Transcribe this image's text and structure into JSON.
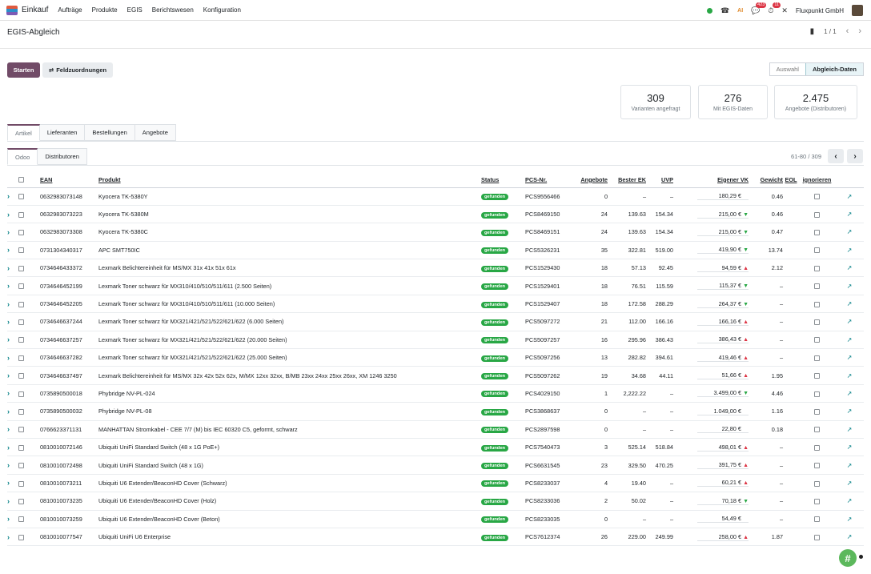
{
  "navbar": {
    "brand": "Einkauf",
    "menu": [
      "Aufträge",
      "Produkte",
      "EGIS",
      "Berichtswesen",
      "Konfiguration"
    ],
    "messages_badge": "423",
    "activity_badge": "11",
    "ai_label": "AI",
    "company": "Fluxpunkt GmbH"
  },
  "control": {
    "title": "EGIS-Abgleich",
    "pager": "1 / 1",
    "start_label": "Starten",
    "field_map_label": "Feldzuordnungen",
    "steps": [
      "Auswahl",
      "Abgleich-Daten"
    ]
  },
  "stats": [
    {
      "value": "309",
      "label": "Varianten angefragt"
    },
    {
      "value": "276",
      "label": "Mit EGIS-Daten"
    },
    {
      "value": "2.475",
      "label": "Angebote (Distributoren)"
    }
  ],
  "tabs": [
    "Artikel",
    "Lieferanten",
    "Bestellungen",
    "Angebote"
  ],
  "subtabs": [
    "Odoo",
    "Distributoren"
  ],
  "list_pager": "61-80 / 309",
  "columns": {
    "ean": "EAN",
    "produkt": "Produkt",
    "status": "Status",
    "pcs": "PCS-Nr.",
    "angebote": "Angebote",
    "bester_ek": "Bester EK",
    "uvp": "UVP",
    "eigener_vk": "Eigener VK",
    "gewicht": "Gewicht",
    "eol": "EOL",
    "ignorieren": "ignorieren"
  },
  "rows": [
    {
      "ean": "0632983073148",
      "produkt": "Kyocera TK-5380Y",
      "status": "gefunden",
      "pcs": "PCS9556466",
      "angebote": "0",
      "ek": "–",
      "uvp": "–",
      "vk": "180,29 €",
      "trend": "",
      "gewicht": "0.46"
    },
    {
      "ean": "0632983073223",
      "produkt": "Kyocera TK-5380M",
      "status": "gefunden",
      "pcs": "PCS8469150",
      "angebote": "24",
      "ek": "139.63",
      "uvp": "154.34",
      "vk": "215,00 €",
      "trend": "down",
      "gewicht": "0.46"
    },
    {
      "ean": "0632983073308",
      "produkt": "Kyocera TK-5380C",
      "status": "gefunden",
      "pcs": "PCS8469151",
      "angebote": "24",
      "ek": "139.63",
      "uvp": "154.34",
      "vk": "215,00 €",
      "trend": "down",
      "gewicht": "0.47"
    },
    {
      "ean": "0731304340317",
      "produkt": "APC SMT750IC",
      "status": "gefunden",
      "pcs": "PCS5326231",
      "angebote": "35",
      "ek": "322.81",
      "uvp": "519.00",
      "vk": "419,90 €",
      "trend": "down",
      "gewicht": "13.74"
    },
    {
      "ean": "0734646433372",
      "produkt": "Lexmark Belichtereinheit für MS/MX 31x 41x 51x 61x",
      "status": "gefunden",
      "pcs": "PCS1529430",
      "angebote": "18",
      "ek": "57.13",
      "uvp": "92.45",
      "vk": "94,59 €",
      "trend": "up",
      "gewicht": "2.12"
    },
    {
      "ean": "0734646452199",
      "produkt": "Lexmark Toner schwarz für MX310/410/510/511/611 (2.500 Seiten)",
      "status": "gefunden",
      "pcs": "PCS1529401",
      "angebote": "18",
      "ek": "76.51",
      "uvp": "115.59",
      "vk": "115,37 €",
      "trend": "down",
      "gewicht": "–"
    },
    {
      "ean": "0734646452205",
      "produkt": "Lexmark Toner schwarz für MX310/410/510/511/611 (10.000 Seiten)",
      "status": "gefunden",
      "pcs": "PCS1529407",
      "angebote": "18",
      "ek": "172.58",
      "uvp": "288.29",
      "vk": "264,37 €",
      "trend": "down",
      "gewicht": "–"
    },
    {
      "ean": "0734646637244",
      "produkt": "Lexmark Toner schwarz für MX321/421/521/522/621/622 (6.000 Seiten)",
      "status": "gefunden",
      "pcs": "PCS5097272",
      "angebote": "21",
      "ek": "112.00",
      "uvp": "166.16",
      "vk": "166,16 €",
      "trend": "up",
      "gewicht": "–"
    },
    {
      "ean": "0734646637257",
      "produkt": "Lexmark Toner schwarz für MX321/421/521/522/621/622 (20.000 Seiten)",
      "status": "gefunden",
      "pcs": "PCS5097257",
      "angebote": "16",
      "ek": "295.96",
      "uvp": "386.43",
      "vk": "386,43 €",
      "trend": "up",
      "gewicht": "–"
    },
    {
      "ean": "0734646637282",
      "produkt": "Lexmark Toner schwarz für MX321/421/521/522/621/622 (25.000 Seiten)",
      "status": "gefunden",
      "pcs": "PCS5097256",
      "angebote": "13",
      "ek": "282.82",
      "uvp": "394.61",
      "vk": "419,46 €",
      "trend": "up",
      "gewicht": "–"
    },
    {
      "ean": "0734646637497",
      "produkt": "Lexmark Belichtereinheit für MS/MX 32x 42x 52x 62x, M/MX 12xx 32xx, B/MB 23xx 24xx 25xx 26xx, XM 1246 3250",
      "status": "gefunden",
      "pcs": "PCS5097262",
      "angebote": "19",
      "ek": "34.68",
      "uvp": "44.11",
      "vk": "51,66 €",
      "trend": "up",
      "gewicht": "1.95"
    },
    {
      "ean": "0735890500018",
      "produkt": "Phybridge NV-PL-024",
      "status": "gefunden",
      "pcs": "PCS4029150",
      "angebote": "1",
      "ek": "2,222.22",
      "uvp": "–",
      "vk": "3.499,00 €",
      "trend": "down",
      "gewicht": "4.46"
    },
    {
      "ean": "0735890500032",
      "produkt": "Phybridge NV-PL-08",
      "status": "gefunden",
      "pcs": "PCS3868637",
      "angebote": "0",
      "ek": "–",
      "uvp": "–",
      "vk": "1.049,00 €",
      "trend": "",
      "gewicht": "1.16"
    },
    {
      "ean": "0766623371131",
      "produkt": "MANHATTAN Stromkabel - CEE 7/7 (M) bis IEC 60320 C5, geformt, schwarz",
      "status": "gefunden",
      "pcs": "PCS2897598",
      "angebote": "0",
      "ek": "–",
      "uvp": "–",
      "vk": "22,80 €",
      "trend": "",
      "gewicht": "0.18"
    },
    {
      "ean": "0810010072146",
      "produkt": "Ubiquiti UniFi Standard Switch (48 x 1G PoE+)",
      "status": "gefunden",
      "pcs": "PCS7540473",
      "angebote": "3",
      "ek": "525.14",
      "uvp": "518.84",
      "vk": "498,01 €",
      "trend": "up",
      "gewicht": "–"
    },
    {
      "ean": "0810010072498",
      "produkt": "Ubiquiti UniFi Standard Switch (48 x 1G)",
      "status": "gefunden",
      "pcs": "PCS6631545",
      "angebote": "23",
      "ek": "329.50",
      "uvp": "470.25",
      "vk": "391,75 €",
      "trend": "up",
      "gewicht": "–"
    },
    {
      "ean": "0810010073211",
      "produkt": "Ubiquiti U6 Extender/BeaconHD Cover (Schwarz)",
      "status": "gefunden",
      "pcs": "PCS8233037",
      "angebote": "4",
      "ek": "19.40",
      "uvp": "–",
      "vk": "60,21 €",
      "trend": "up",
      "gewicht": "–"
    },
    {
      "ean": "0810010073235",
      "produkt": "Ubiquiti U6 Extender/BeaconHD Cover (Holz)",
      "status": "gefunden",
      "pcs": "PCS8233036",
      "angebote": "2",
      "ek": "50.02",
      "uvp": "–",
      "vk": "70,18 €",
      "trend": "down",
      "gewicht": "–"
    },
    {
      "ean": "0810010073259",
      "produkt": "Ubiquiti U6 Extender/BeaconHD Cover (Beton)",
      "status": "gefunden",
      "pcs": "PCS8233035",
      "angebote": "0",
      "ek": "–",
      "uvp": "–",
      "vk": "54,49 €",
      "trend": "",
      "gewicht": "–"
    },
    {
      "ean": "0810010077547",
      "produkt": "Ubiquiti UniFi U6 Enterprise",
      "status": "gefunden",
      "pcs": "PCS7612374",
      "angebote": "26",
      "ek": "229.00",
      "uvp": "249.99",
      "vk": "258,00 €",
      "trend": "up",
      "gewicht": "1.87"
    }
  ],
  "colors": {
    "brand": "#714b67",
    "status": "#28a745",
    "up": "#dc3545",
    "down": "#28a745",
    "link": "#017e84"
  }
}
